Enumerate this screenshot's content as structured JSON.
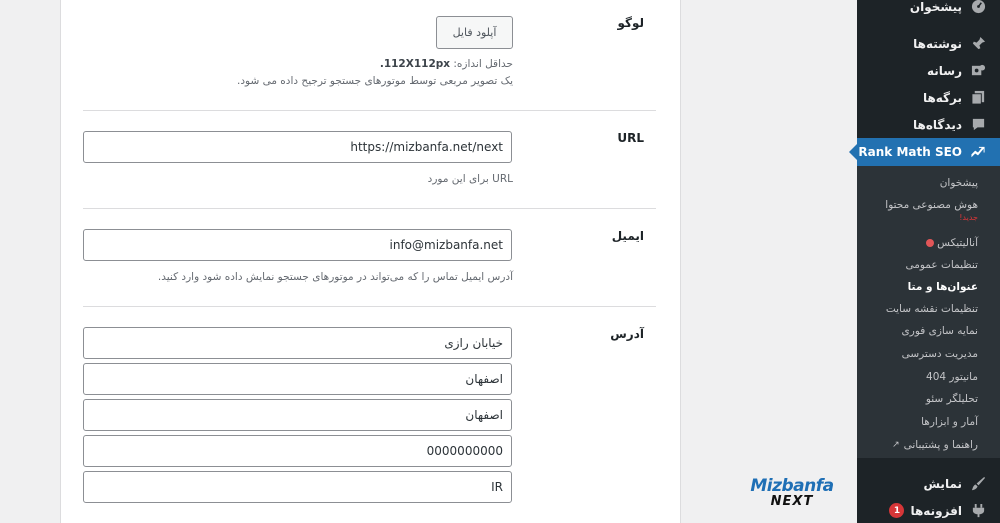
{
  "form": {
    "logo": {
      "label": "لوگو",
      "upload_button": "آپلود فایل",
      "min_size_prefix": "حداقل اندازه: ",
      "min_size_value": "112X112px.",
      "hint": "یک تصویر مربعی توسط موتورهای جستجو ترجیح داده می شود."
    },
    "url": {
      "label": "URL",
      "value": "https://mizbanfa.net/next",
      "hint": "URL برای این مورد"
    },
    "email": {
      "label": "ایمیل",
      "value": "info@mizbanfa.net",
      "hint": "آدرس ایمیل تماس را که می‌تواند در موتورهای جستجو نمایش داده شود وارد کنید."
    },
    "address": {
      "label": "آدرس",
      "street": "خیابان رازی",
      "city": "اصفهان",
      "state": "اصفهان",
      "postal_code": "0000000000",
      "country": "IR"
    }
  },
  "sidebar": {
    "dashboard": "پیشخوان",
    "posts": "نوشته‌ها",
    "media": "رسانه",
    "pages": "برگه‌ها",
    "comments": "دیدگاه‌ها",
    "rank_math": "Rank Math SEO",
    "appearance": "نمایش",
    "plugins": "افزونه‌ها",
    "plugins_badge": "1",
    "submenu": {
      "dashboard": "پیشخوان",
      "ai_content": "هوش مصنوعی محتوا",
      "new_tag": "جدید!",
      "analytics": "آنالیتیکس",
      "general": "تنظیمات عمومی",
      "titles_meta": "عنوان‌ها و متا",
      "sitemap": "تنظیمات نقشه سایت",
      "instant_indexing": "نمایه سازی فوری",
      "role_manager": "مدیریت دسترسی",
      "monitor_404": "مانیتور 404",
      "seo_analyzer": "تحلیلگر سئو",
      "status_tools": "آمار و ابزارها",
      "help": "راهنما و پشتیبانی"
    }
  },
  "watermark": {
    "line1": "Mizbanfa",
    "line2": "NEXT"
  },
  "colors": {
    "accent": "#2271b1",
    "sidebar_bg": "#1d2327",
    "submenu_bg": "#2c3338",
    "alert": "#d63638"
  }
}
